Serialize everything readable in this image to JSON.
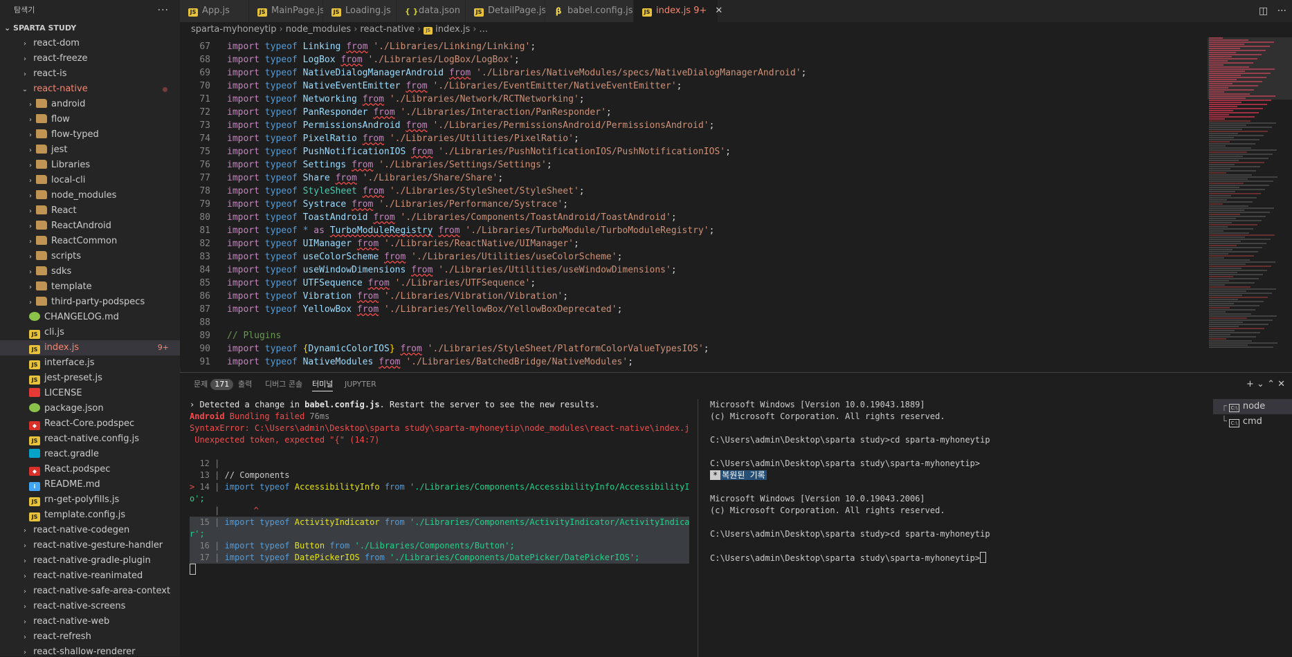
{
  "sidebar": {
    "title": "탐색기",
    "section": "SPARTA STUDY",
    "items": [
      {
        "label": "react-dom",
        "indent": 1,
        "chev": "›",
        "icon": "",
        "state": ""
      },
      {
        "label": "react-freeze",
        "indent": 1,
        "chev": "›",
        "icon": "",
        "state": ""
      },
      {
        "label": "react-is",
        "indent": 1,
        "chev": "›",
        "icon": "",
        "state": ""
      },
      {
        "label": "react-native",
        "indent": 1,
        "chev": "⌄",
        "icon": "",
        "state": "err"
      },
      {
        "label": "android",
        "indent": 2,
        "chev": "›",
        "icon": "folder",
        "state": ""
      },
      {
        "label": "flow",
        "indent": 2,
        "chev": "›",
        "icon": "folder",
        "state": ""
      },
      {
        "label": "flow-typed",
        "indent": 2,
        "chev": "›",
        "icon": "folder",
        "state": ""
      },
      {
        "label": "jest",
        "indent": 2,
        "chev": "›",
        "icon": "folder",
        "state": ""
      },
      {
        "label": "Libraries",
        "indent": 2,
        "chev": "›",
        "icon": "folder",
        "state": ""
      },
      {
        "label": "local-cli",
        "indent": 2,
        "chev": "›",
        "icon": "folder",
        "state": ""
      },
      {
        "label": "node_modules",
        "indent": 2,
        "chev": "›",
        "icon": "folder",
        "state": ""
      },
      {
        "label": "React",
        "indent": 2,
        "chev": "›",
        "icon": "folder",
        "state": ""
      },
      {
        "label": "ReactAndroid",
        "indent": 2,
        "chev": "›",
        "icon": "folder",
        "state": ""
      },
      {
        "label": "ReactCommon",
        "indent": 2,
        "chev": "›",
        "icon": "folder",
        "state": ""
      },
      {
        "label": "scripts",
        "indent": 2,
        "chev": "›",
        "icon": "folder",
        "state": ""
      },
      {
        "label": "sdks",
        "indent": 2,
        "chev": "›",
        "icon": "folder",
        "state": ""
      },
      {
        "label": "template",
        "indent": 2,
        "chev": "›",
        "icon": "folder",
        "state": ""
      },
      {
        "label": "third-party-podspecs",
        "indent": 2,
        "chev": "›",
        "icon": "folder",
        "state": ""
      },
      {
        "label": "CHANGELOG.md",
        "indent": 2,
        "chev": "",
        "icon": "hist",
        "state": ""
      },
      {
        "label": "cli.js",
        "indent": 2,
        "chev": "",
        "icon": "js",
        "state": ""
      },
      {
        "label": "index.js",
        "indent": 2,
        "chev": "",
        "icon": "js",
        "state": "err",
        "badge": "9+"
      },
      {
        "label": "interface.js",
        "indent": 2,
        "chev": "",
        "icon": "js",
        "state": ""
      },
      {
        "label": "jest-preset.js",
        "indent": 2,
        "chev": "",
        "icon": "js",
        "state": ""
      },
      {
        "label": "LICENSE",
        "indent": 2,
        "chev": "",
        "icon": "lic",
        "state": ""
      },
      {
        "label": "package.json",
        "indent": 2,
        "chev": "",
        "icon": "pkg",
        "state": ""
      },
      {
        "label": "React-Core.podspec",
        "indent": 2,
        "chev": "",
        "icon": "ruby",
        "state": ""
      },
      {
        "label": "react-native.config.js",
        "indent": 2,
        "chev": "",
        "icon": "js",
        "state": ""
      },
      {
        "label": "react.gradle",
        "indent": 2,
        "chev": "",
        "icon": "gradle",
        "state": ""
      },
      {
        "label": "React.podspec",
        "indent": 2,
        "chev": "",
        "icon": "ruby",
        "state": ""
      },
      {
        "label": "README.md",
        "indent": 2,
        "chev": "",
        "icon": "md",
        "state": ""
      },
      {
        "label": "rn-get-polyfills.js",
        "indent": 2,
        "chev": "",
        "icon": "js",
        "state": ""
      },
      {
        "label": "template.config.js",
        "indent": 2,
        "chev": "",
        "icon": "js",
        "state": ""
      },
      {
        "label": "react-native-codegen",
        "indent": 1,
        "chev": "›",
        "icon": "",
        "state": ""
      },
      {
        "label": "react-native-gesture-handler",
        "indent": 1,
        "chev": "›",
        "icon": "",
        "state": ""
      },
      {
        "label": "react-native-gradle-plugin",
        "indent": 1,
        "chev": "›",
        "icon": "",
        "state": ""
      },
      {
        "label": "react-native-reanimated",
        "indent": 1,
        "chev": "›",
        "icon": "",
        "state": ""
      },
      {
        "label": "react-native-safe-area-context",
        "indent": 1,
        "chev": "›",
        "icon": "",
        "state": ""
      },
      {
        "label": "react-native-screens",
        "indent": 1,
        "chev": "›",
        "icon": "",
        "state": ""
      },
      {
        "label": "react-native-web",
        "indent": 1,
        "chev": "›",
        "icon": "",
        "state": ""
      },
      {
        "label": "react-refresh",
        "indent": 1,
        "chev": "›",
        "icon": "",
        "state": ""
      },
      {
        "label": "react-shallow-renderer",
        "indent": 1,
        "chev": "›",
        "icon": "",
        "state": ""
      }
    ]
  },
  "tabs": [
    {
      "label": "App.js",
      "icon": "JS",
      "kind": "js"
    },
    {
      "label": "MainPage.js",
      "icon": "JS",
      "kind": "js"
    },
    {
      "label": "Loading.js",
      "icon": "JS",
      "kind": "js"
    },
    {
      "label": "data.json",
      "icon": "{ }",
      "kind": "json"
    },
    {
      "label": "DetailPage.js",
      "icon": "JS",
      "kind": "js"
    },
    {
      "label": "babel.config.js",
      "icon": "β",
      "kind": "babel"
    },
    {
      "label": "index.js 9+",
      "icon": "JS",
      "kind": "js",
      "active": true
    }
  ],
  "breadcrumb": [
    "sparta-myhoneytip",
    "node_modules",
    "react-native",
    "index.js",
    "..."
  ],
  "editor": {
    "lines": [
      {
        "n": "67",
        "name": "Linking",
        "path": "'./Libraries/Linking/Linking'"
      },
      {
        "n": "68",
        "name": "LogBox",
        "path": "'./Libraries/LogBox/LogBox'"
      },
      {
        "n": "69",
        "name": "NativeDialogManagerAndroid",
        "path": "'./Libraries/NativeModules/specs/NativeDialogManagerAndroid'"
      },
      {
        "n": "70",
        "name": "NativeEventEmitter",
        "path": "'./Libraries/EventEmitter/NativeEventEmitter'"
      },
      {
        "n": "71",
        "name": "Networking",
        "path": "'./Libraries/Network/RCTNetworking'"
      },
      {
        "n": "72",
        "name": "PanResponder",
        "path": "'./Libraries/Interaction/PanResponder'"
      },
      {
        "n": "73",
        "name": "PermissionsAndroid",
        "path": "'./Libraries/PermissionsAndroid/PermissionsAndroid'"
      },
      {
        "n": "74",
        "name": "PixelRatio",
        "path": "'./Libraries/Utilities/PixelRatio'"
      },
      {
        "n": "75",
        "name": "PushNotificationIOS",
        "path": "'./Libraries/PushNotificationIOS/PushNotificationIOS'"
      },
      {
        "n": "76",
        "name": "Settings",
        "path": "'./Libraries/Settings/Settings'"
      },
      {
        "n": "77",
        "name": "Share",
        "path": "'./Libraries/Share/Share'"
      },
      {
        "n": "78",
        "name": "StyleSheet",
        "path": "'./Libraries/StyleSheet/StyleSheet'",
        "cls": true
      },
      {
        "n": "79",
        "name": "Systrace",
        "path": "'./Libraries/Performance/Systrace'"
      },
      {
        "n": "80",
        "name": "ToastAndroid",
        "path": "'./Libraries/Components/ToastAndroid/ToastAndroid'"
      },
      {
        "n": "81",
        "name": "TurboModuleRegistry",
        "path": "'./Libraries/TurboModule/TurboModuleRegistry'",
        "star": true
      },
      {
        "n": "82",
        "name": "UIManager",
        "path": "'./Libraries/ReactNative/UIManager'"
      },
      {
        "n": "83",
        "name": "useColorScheme",
        "path": "'./Libraries/Utilities/useColorScheme'"
      },
      {
        "n": "84",
        "name": "useWindowDimensions",
        "path": "'./Libraries/Utilities/useWindowDimensions'"
      },
      {
        "n": "85",
        "name": "UTFSequence",
        "path": "'./Libraries/UTFSequence'"
      },
      {
        "n": "86",
        "name": "Vibration",
        "path": "'./Libraries/Vibration/Vibration'"
      },
      {
        "n": "87",
        "name": "YellowBox",
        "path": "'./Libraries/YellowBox/YellowBoxDeprecated'"
      },
      {
        "n": "88",
        "blank": true
      },
      {
        "n": "89",
        "comment": "// Plugins"
      },
      {
        "n": "90",
        "name": "DynamicColorIOS",
        "path": "'./Libraries/StyleSheet/PlatformColorValueTypesIOS'",
        "braces": true
      },
      {
        "n": "91",
        "name": "NativeModules",
        "path": "'./Libraries/BatchedBridge/NativeModules'"
      }
    ]
  },
  "panel": {
    "tabs": [
      {
        "label": "문제",
        "badge": "171"
      },
      {
        "label": "출력"
      },
      {
        "label": "디버그 콘솔"
      },
      {
        "label": "터미널",
        "active": true
      },
      {
        "label": "JUPYTER"
      }
    ],
    "actions": "+ ⌄   ⌃  ✕"
  },
  "terminal1": {
    "detect_pre": "› Detected a change in ",
    "detect_file": "babel.config.js",
    "detect_post": ". Restart the server to see the new results.",
    "bundling_platform": "Android",
    "bundling_text": " Bundling failed ",
    "bundling_time": "76ms",
    "error_line1": "SyntaxError: C:\\Users\\admin\\Desktop\\sparta study\\sparta-myhoneytip\\node_modules\\react-native\\index.js:",
    "error_line2": " Unexpected token, expected \"{\" (14:7)",
    "code": [
      {
        "n": "12",
        "marker": "  ",
        "text": "",
        "type": "blank"
      },
      {
        "n": "13",
        "marker": "  ",
        "text": "// Components",
        "type": "comment"
      },
      {
        "n": "14",
        "marker": "> ",
        "name": "AccessibilityInfo",
        "path": "'./Libraries/Components/AccessibilityInfo/AccessibilityInf",
        "wrap": "o';",
        "type": "import"
      },
      {
        "n": "15",
        "marker": "  ",
        "name": "ActivityIndicator",
        "path": "'./Libraries/Components/ActivityIndicator/ActivityIndicato",
        "wrap": "r';",
        "type": "import",
        "hl": true
      },
      {
        "n": "16",
        "marker": "  ",
        "name": "Button",
        "path": "'./Libraries/Components/Button';",
        "type": "import",
        "hl": true
      },
      {
        "n": "17",
        "marker": "  ",
        "name": "DatePickerIOS",
        "path": "'./Libraries/Components/DatePicker/DatePickerIOS';",
        "type": "import",
        "hl": true
      }
    ],
    "caret": "^"
  },
  "terminal2": {
    "lines": [
      "Microsoft Windows [Version 10.0.19043.1889]",
      "(c) Microsoft Corporation. All rights reserved.",
      "",
      "C:\\Users\\admin\\Desktop\\sparta study>cd sparta-myhoneytip",
      "",
      "C:\\Users\\admin\\Desktop\\sparta study\\sparta-myhoneytip>"
    ],
    "restored_star": "*",
    "restored_label": "복원된 기록",
    "lines2": [
      "",
      "Microsoft Windows [Version 10.0.19043.2006]",
      "(c) Microsoft Corporation. All rights reserved.",
      "",
      "C:\\Users\\admin\\Desktop\\sparta study>cd sparta-myhoneytip",
      "",
      "C:\\Users\\admin\\Desktop\\sparta study\\sparta-myhoneytip>"
    ]
  },
  "terminal_list": [
    {
      "label": "node",
      "icon": "C:\\",
      "active": true
    },
    {
      "label": "cmd",
      "icon": "C:\\"
    }
  ],
  "keywords": {
    "import": "import",
    "typeof": "typeof",
    "from": "from",
    "as": "as",
    "star": "*"
  }
}
